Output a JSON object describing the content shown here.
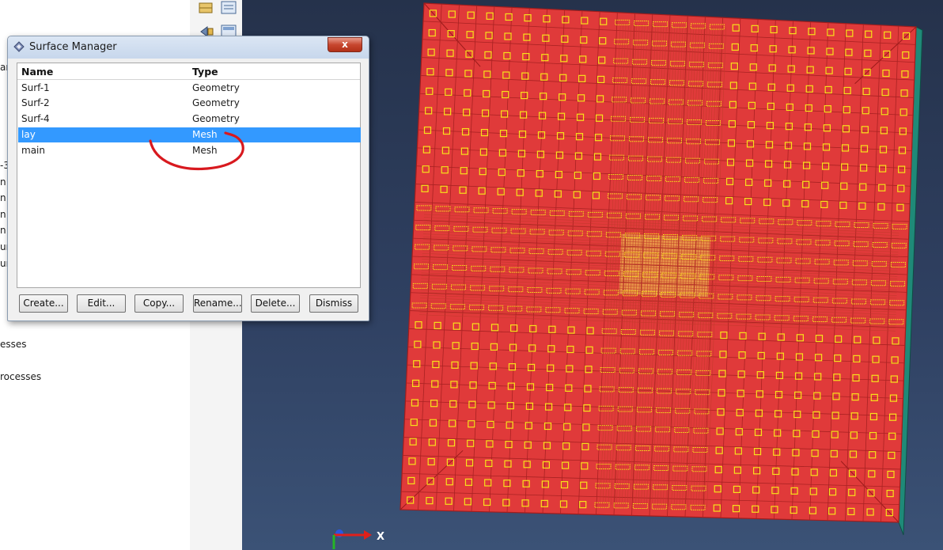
{
  "model_tree": {
    "fragments": [
      "ar",
      "-3",
      "n",
      "n",
      "n",
      "n",
      "ur",
      "ur",
      "esses",
      "rocesses"
    ]
  },
  "toolbox": {
    "icons": [
      "create-part-icon",
      "part-manager-icon",
      "assembly-icon",
      "instance-manager-icon"
    ]
  },
  "dialog": {
    "title": "Surface Manager",
    "close_label": "x",
    "columns": {
      "name": "Name",
      "type": "Type"
    },
    "rows": [
      {
        "name": "Surf-1",
        "type": "Geometry"
      },
      {
        "name": "Surf-2",
        "type": "Geometry"
      },
      {
        "name": "Surf-4",
        "type": "Geometry"
      },
      {
        "name": "lay",
        "type": "Mesh"
      },
      {
        "name": "main",
        "type": "Mesh"
      }
    ],
    "selected_row": "lay",
    "buttons": {
      "create": "Create...",
      "edit": "Edit...",
      "copy": "Copy...",
      "rename": "Rename...",
      "delete": "Delete...",
      "dismiss": "Dismiss"
    }
  },
  "viewport": {
    "triad_axis": "X",
    "highlight_color": "#e03a3a",
    "node_marker_color": "#f7e21a",
    "background_color": "#2b3a57"
  }
}
